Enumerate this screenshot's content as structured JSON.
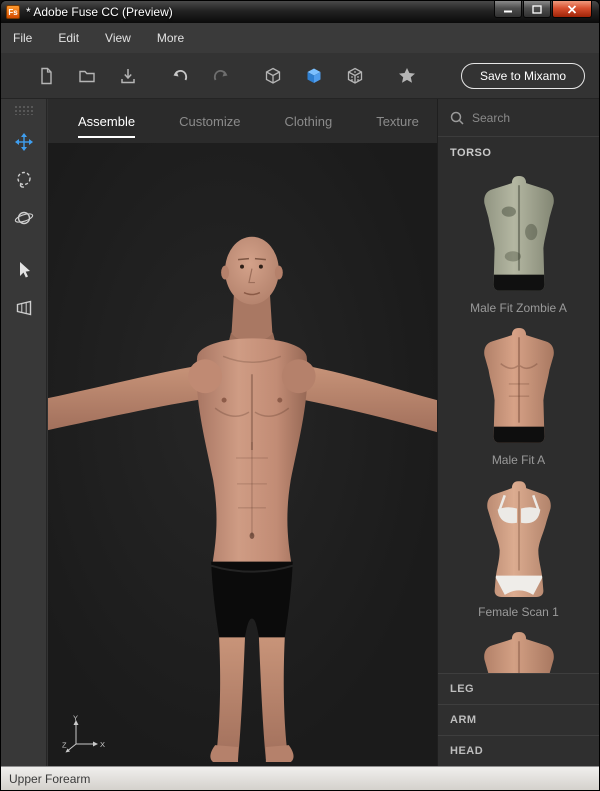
{
  "window": {
    "icon_text": "Fs",
    "title": "* Adobe Fuse CC (Preview)"
  },
  "menu": {
    "items": [
      "File",
      "Edit",
      "View",
      "More"
    ]
  },
  "toolbar": {
    "icons": [
      "new-document",
      "open-folder",
      "import",
      "undo",
      "redo",
      "cube-wireframe",
      "cube-solid",
      "cube-textured",
      "star"
    ],
    "save_button_label": "Save to Mixamo"
  },
  "tools": {
    "items": [
      "move",
      "lasso",
      "orbit",
      "select",
      "camera"
    ],
    "active": "move"
  },
  "tabs": [
    {
      "label": "Assemble",
      "active": true
    },
    {
      "label": "Customize",
      "active": false
    },
    {
      "label": "Clothing",
      "active": false
    },
    {
      "label": "Texture",
      "active": false
    }
  ],
  "viewport": {
    "gizmo": {
      "x": "X",
      "y": "Y",
      "z": "Z"
    }
  },
  "library": {
    "search_placeholder": "Search",
    "sections": [
      {
        "label": "TORSO",
        "expanded": true,
        "items": [
          {
            "label": "Male Fit Zombie A"
          },
          {
            "label": "Male Fit A"
          },
          {
            "label": "Female Scan 1"
          }
        ]
      },
      {
        "label": "LEG",
        "expanded": false
      },
      {
        "label": "ARM",
        "expanded": false
      },
      {
        "label": "HEAD",
        "expanded": false
      }
    ]
  },
  "statusbar": {
    "text": "Upper Forearm"
  },
  "colors": {
    "accent": "#3f9ff0",
    "skin": "#c6907c",
    "panel": "#2d2d2d",
    "viewport_bg": "#1c1c1c"
  }
}
